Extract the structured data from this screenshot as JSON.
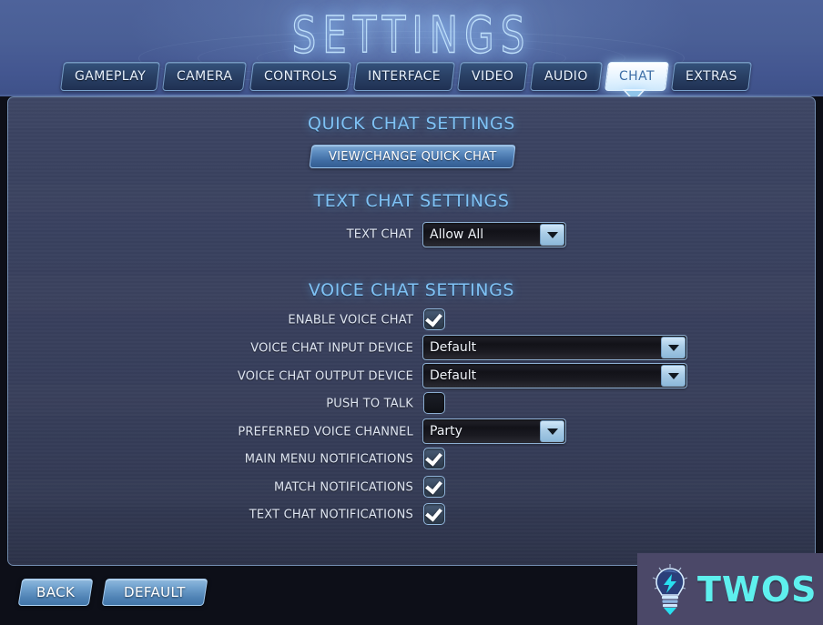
{
  "header": {
    "title": "SETTINGS",
    "tabs": [
      {
        "label": "GAMEPLAY",
        "active": false
      },
      {
        "label": "CAMERA",
        "active": false
      },
      {
        "label": "CONTROLS",
        "active": false
      },
      {
        "label": "INTERFACE",
        "active": false
      },
      {
        "label": "VIDEO",
        "active": false
      },
      {
        "label": "AUDIO",
        "active": false
      },
      {
        "label": "CHAT",
        "active": true
      },
      {
        "label": "EXTRAS",
        "active": false
      }
    ]
  },
  "sections": {
    "quick_chat": {
      "title": "QUICK CHAT SETTINGS",
      "button_label": "VIEW/CHANGE QUICK CHAT"
    },
    "text_chat": {
      "title": "TEXT CHAT SETTINGS",
      "rows": [
        {
          "label": "TEXT CHAT",
          "type": "dropdown",
          "value": "Allow All"
        }
      ]
    },
    "voice_chat": {
      "title": "VOICE CHAT SETTINGS",
      "rows": [
        {
          "label": "ENABLE VOICE CHAT",
          "type": "checkbox",
          "checked": true
        },
        {
          "label": "VOICE CHAT INPUT DEVICE",
          "type": "dropdown",
          "value": "Default"
        },
        {
          "label": "VOICE CHAT OUTPUT DEVICE",
          "type": "dropdown",
          "value": "Default"
        },
        {
          "label": "PUSH TO TALK",
          "type": "checkbox",
          "checked": false
        },
        {
          "label": "PREFERRED VOICE CHANNEL",
          "type": "dropdown",
          "value": "Party"
        },
        {
          "label": "MAIN MENU NOTIFICATIONS",
          "type": "checkbox",
          "checked": true
        },
        {
          "label": "MATCH NOTIFICATIONS",
          "type": "checkbox",
          "checked": true
        },
        {
          "label": "TEXT CHAT NOTIFICATIONS",
          "type": "checkbox",
          "checked": true
        }
      ]
    }
  },
  "footer": {
    "back_label": "BACK",
    "default_label": "DEFAULT"
  },
  "watermark": {
    "text": "TWOS"
  },
  "colors": {
    "accent_cyan": "#7fc2f5",
    "tab_active_bg": "#e9f5ff",
    "tab_active_text": "#3d6ea6",
    "header_blue": "#4a5f96",
    "panel_bg": "#39405d",
    "label_text": "#dfe6f2",
    "watermark_cyan": "#5ef0ee",
    "watermark_bg": "#4b4868"
  }
}
